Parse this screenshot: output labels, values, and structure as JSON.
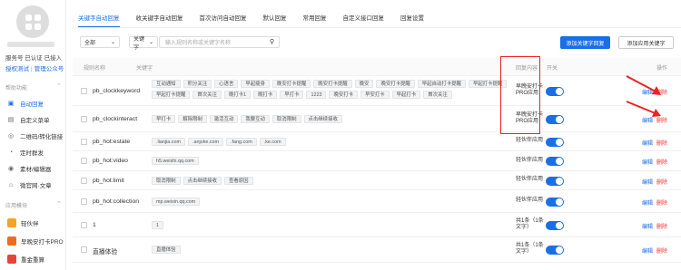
{
  "sidebar": {
    "account_status": "服务号 已认证 已接入",
    "link_switch": "授权测试",
    "link_manage": "管理公众号",
    "section_dev": "帮助功能",
    "section_apps": "应用模块",
    "items": [
      {
        "label": "自动回复",
        "icon": "reply-icon"
      },
      {
        "label": "自定义菜单",
        "icon": "menu-icon"
      },
      {
        "label": "二维码/转化链接",
        "icon": "qrcode-icon"
      },
      {
        "label": "定时群发",
        "icon": "clock-icon"
      },
      {
        "label": "素材/编辑器",
        "icon": "material-icon"
      },
      {
        "label": "微官网·文章",
        "icon": "site-icon"
      }
    ],
    "apps": [
      {
        "label": "轻伙伴",
        "color": "#f4a623"
      },
      {
        "label": "早晚安打卡PRO",
        "color": "#f26b1d"
      },
      {
        "label": "重金重算",
        "color": "#e8433a"
      }
    ]
  },
  "tabs": [
    "关键字自动回复",
    "收关键字自动回复",
    "首次访问自动回复",
    "默认回复",
    "常用回复",
    "自定义接口回复",
    "回复设置"
  ],
  "filter": {
    "scope": "全部",
    "field": "关键字",
    "search_placeholder": "输入规则名称或关键字名称"
  },
  "buttons": {
    "add_reply": "添加关键字回复",
    "add_app_reply": "添加应用关键字"
  },
  "columns": {
    "name": "规则名称",
    "keywords": "关键字",
    "reply": "回复内容",
    "switch": "开关",
    "ops": "操作"
  },
  "rows": [
    {
      "name": "pb_clockkeyword",
      "reply": [
        "早晚安打卡",
        "PRO应用"
      ],
      "keywords": [
        "互动通知",
        "积分关注",
        "心语言",
        "早起瘦身",
        "晚安打卡提醒",
        "晚安打卡提醒",
        "晚安",
        "晚安打卡提醒",
        "早起自动打卡提醒",
        "早起打卡提醒",
        "早起打卡提醒",
        "首次关注",
        "晚打卡1",
        "晚打卡",
        "早打卡",
        "1223",
        "晚安打卡",
        "早安打卡",
        "早起打卡",
        "首次关注"
      ]
    },
    {
      "name": "pb_clockinteract",
      "reply": [
        "早晚安打卡",
        "PRO应用"
      ],
      "keywords": [
        "早打卡",
        "解除限制",
        "激活互动",
        "我要互动",
        "取消限制",
        "点击继续接收"
      ]
    },
    {
      "name": "pb_hot:estate",
      "reply": [
        "轻伙伴应用"
      ],
      "keywords": [
        ".lianjia.com",
        ".anjuke.com",
        ".fang.com",
        ".ke.com"
      ]
    },
    {
      "name": "pb_hot:video",
      "reply": [
        "轻伙伴应用"
      ],
      "keywords": [
        "h5.weishi.qq.com"
      ]
    },
    {
      "name": "pb_hot:limit",
      "reply": [
        "轻伙伴应用"
      ],
      "keywords": [
        "取消限制",
        "点击继续接收",
        "查看原因"
      ]
    },
    {
      "name": "pb_hot:collection",
      "reply": [
        "轻伙伴应用"
      ],
      "keywords": [
        "mp.weixin.qq.com"
      ]
    },
    {
      "name": "1",
      "reply": [
        "共1条（1条",
        "文字）"
      ],
      "keywords": [
        "1"
      ]
    },
    {
      "name": "直播体验",
      "reply": [
        "共1条（1条",
        "文字）"
      ],
      "keywords": [
        "直播体验"
      ]
    }
  ],
  "op_labels": {
    "edit": "编辑",
    "delete": "删除"
  }
}
